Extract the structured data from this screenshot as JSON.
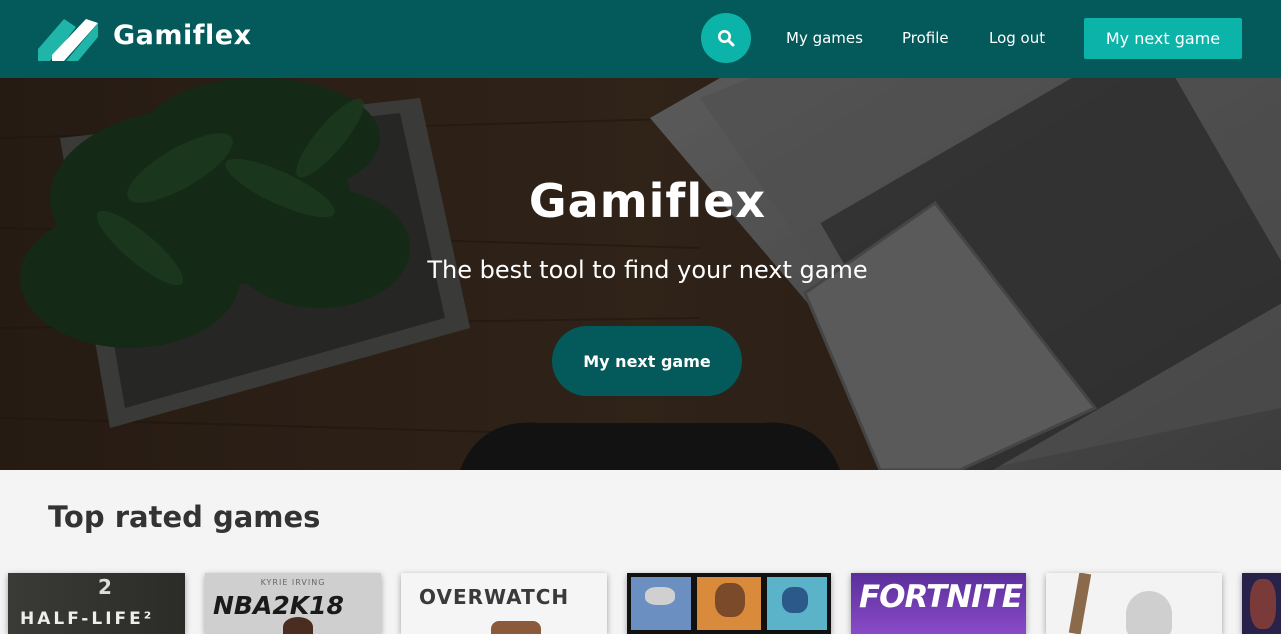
{
  "navbar": {
    "brand": "Gamiflex",
    "links": {
      "my_games": "My games",
      "profile": "Profile",
      "logout": "Log out"
    },
    "cta_label": "My next game",
    "search_icon": "search-icon"
  },
  "hero": {
    "title": "Gamiflex",
    "subtitle": "The best tool to find your next game",
    "cta_label": "My next game"
  },
  "top_rated": {
    "title": "Top rated games",
    "games": [
      {
        "cover_text": "HALF-LIFE²",
        "subtitle": "2"
      },
      {
        "cover_text": "NBA2K18",
        "subtitle": "KYRIE IRVING"
      },
      {
        "cover_text": "OVERWATCH"
      },
      {
        "cover_text": ""
      },
      {
        "cover_text": "FORTNITE"
      },
      {
        "cover_text": ""
      },
      {
        "cover_text": ""
      }
    ]
  },
  "colors": {
    "navbar": "#045a5b",
    "accent": "#0bb3a8",
    "page_bg": "#f4f4f4"
  }
}
